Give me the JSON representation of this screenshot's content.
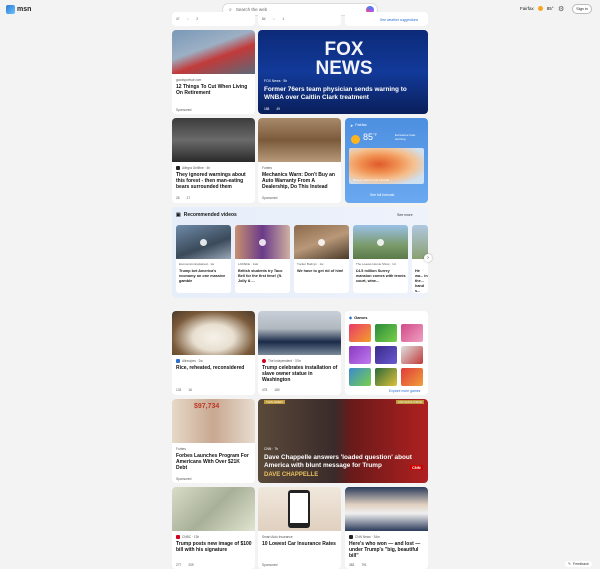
{
  "header": {
    "logo_text": "msn",
    "search_placeholder": "Search the web",
    "browser_label": "Fairfax",
    "temperature": "85°",
    "signin_label": "Sign in"
  },
  "top_row": {
    "reacts_a": [
      "47",
      "",
      "2"
    ],
    "reacts_b": [
      "84",
      "",
      "1"
    ],
    "see_link": "See weather suggestions"
  },
  "cards": {
    "retire": {
      "source": "goodsportsof.com",
      "title": "12 Things To Cut When Living On Retirement",
      "tag": "Sponsored"
    },
    "fox": {
      "source": "FOX News · 5h",
      "title": "Former 76ers team physician sends warning to WNBA over Caitlin Clark treatment",
      "reacts": [
        "188",
        "",
        "49"
      ]
    },
    "forest": {
      "source": "Allegra Gellfine · 4h",
      "title": "They ignored warnings about this forest - then man-eating bears surrounded them",
      "reacts": [
        "26",
        "",
        "17"
      ]
    },
    "mechanics": {
      "source": "Forbes",
      "title": "Mechanics Warn: Don't Buy an Auto Warranty From A Dealership, Do This Instead",
      "tag": "Sponsored"
    },
    "weather": {
      "location": "Fairfax",
      "temp": "85",
      "unit": "°F",
      "note": "Excessive heat warning",
      "caption": "Severe storms and tornado...",
      "button": "See full forecast"
    }
  },
  "videos": {
    "heading": "Recommended videos",
    "see_more": "See more",
    "items": [
      {
        "source": "Economics Explained · 1w",
        "title": "Trump bet America's economy on one massive gamble"
      },
      {
        "source": "LADbible · 1wk",
        "title": "British students try Taco Bell for the first time! (ft. Jolly & ..."
      },
      {
        "source": "Tucker Budzyn · 1w",
        "title": "We have to get rid of him!"
      },
      {
        "source": "The Loaves Homie Show · 1d",
        "title": "£4.5 million Surrey mansion comes with tennis court, wine..."
      },
      {
        "source": "",
        "title": "He wa... in the... hand s..."
      }
    ]
  },
  "cards2": {
    "rice": {
      "source": "Allrecipes · 2w",
      "title": "Rice, reheated, reconsidered",
      "reacts": [
        "133",
        "",
        "16"
      ]
    },
    "trump_statue": {
      "source": "The Independent · 37m",
      "title": "Trump celebrates installation of slave owner statue in Washington",
      "reacts": [
        "475",
        "",
        "180"
      ]
    },
    "games": {
      "heading": "Games",
      "link": "Explore more games"
    },
    "forbes_debt": {
      "source": "Forbes",
      "title": "Forbes Launches Program For Americans With Over $21K Debt",
      "tag": "Sponsored",
      "image_text": "$97,734"
    },
    "chappelle": {
      "source": "CNN · 7h",
      "title": "Dave Chappelle answers 'loaded question' about America with blunt message for Trump",
      "tag_left": "THIS AIRED",
      "tag_right": "CNN EXCLUSIVE",
      "watermark": "DAVE CHAPPELLE",
      "logo": "CNN"
    },
    "hundred": {
      "source": "CNBC · 13h",
      "title": "Trump posts new image of $100 bill with his signature",
      "reacts": [
        "277",
        "",
        "209"
      ]
    },
    "insurance": {
      "source": "Smart Auto Insurance",
      "title": "10 Lowest Car Insurance Rates",
      "tag": "Sponsored"
    },
    "won_lost": {
      "source": "CNN News · 34m",
      "title": "Here's who won — and lost — under Trump's \"big, beautiful bill\"",
      "reacts": [
        "383",
        "",
        "791"
      ]
    }
  },
  "feedback_label": "Feedback"
}
